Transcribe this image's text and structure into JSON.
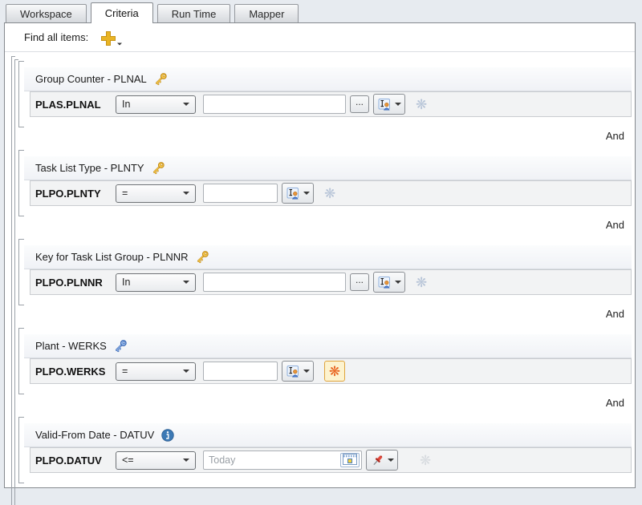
{
  "window": {
    "tabs": [
      {
        "label": "Workspace",
        "active": false
      },
      {
        "label": "Criteria",
        "active": true
      },
      {
        "label": "Run Time",
        "active": false
      },
      {
        "label": "Mapper",
        "active": false
      }
    ]
  },
  "toolbar": {
    "find_label": "Find all items:",
    "add_button_icon": "plus-icon-with-dropdown"
  },
  "ui": {
    "and_label": "And",
    "ellipsis_label": "...",
    "asterisk_glyph": "❋"
  },
  "colors": {
    "key_gold": "#E8B13A",
    "key_blue": "#4F7FD0",
    "info_blue": "#3C79B5",
    "asterisk_muted": "#B8C5D8",
    "asterisk_active": "#E8611C",
    "asterisk_active_bg": "#FDF3CF",
    "asterisk_active_border": "#DFA43C",
    "asterisk_disabled": "#D8DCE0",
    "pin_red": "#D9372B",
    "plus_gold": "#E9B424"
  },
  "criteria": [
    {
      "title": "Group Counter - PLNAL",
      "title_icon": "key-gold",
      "field": "PLAS.PLNAL",
      "operator": "In",
      "value": "",
      "placeholder": "",
      "input_width": "long",
      "has_ellipsis": true,
      "has_calendar": false,
      "picker": "user",
      "asterisk": "muted",
      "and_after": true
    },
    {
      "title": "Task List Type - PLNTY",
      "title_icon": "key-gold",
      "field": "PLPO.PLNTY",
      "operator": "=",
      "value": "",
      "placeholder": "",
      "input_width": "short",
      "has_ellipsis": false,
      "has_calendar": false,
      "picker": "user",
      "asterisk": "muted",
      "and_after": true
    },
    {
      "title": "Key for Task List Group - PLNNR",
      "title_icon": "key-gold",
      "field": "PLPO.PLNNR",
      "operator": "In",
      "value": "",
      "placeholder": "",
      "input_width": "long",
      "has_ellipsis": true,
      "has_calendar": false,
      "picker": "user",
      "asterisk": "muted",
      "and_after": true
    },
    {
      "title": "Plant - WERKS",
      "title_icon": "key-blue",
      "field": "PLPO.WERKS",
      "operator": "=",
      "value": "",
      "placeholder": "",
      "input_width": "short",
      "has_ellipsis": false,
      "has_calendar": false,
      "picker": "user",
      "asterisk": "highlighted",
      "and_after": true
    },
    {
      "title": "Valid-From Date - DATUV",
      "title_icon": "info",
      "field": "PLPO.DATUV",
      "operator": "<=",
      "value": "",
      "placeholder": "Today",
      "input_width": "date",
      "has_ellipsis": false,
      "has_calendar": true,
      "picker": "pin",
      "asterisk": "disabled",
      "and_after": false
    }
  ]
}
